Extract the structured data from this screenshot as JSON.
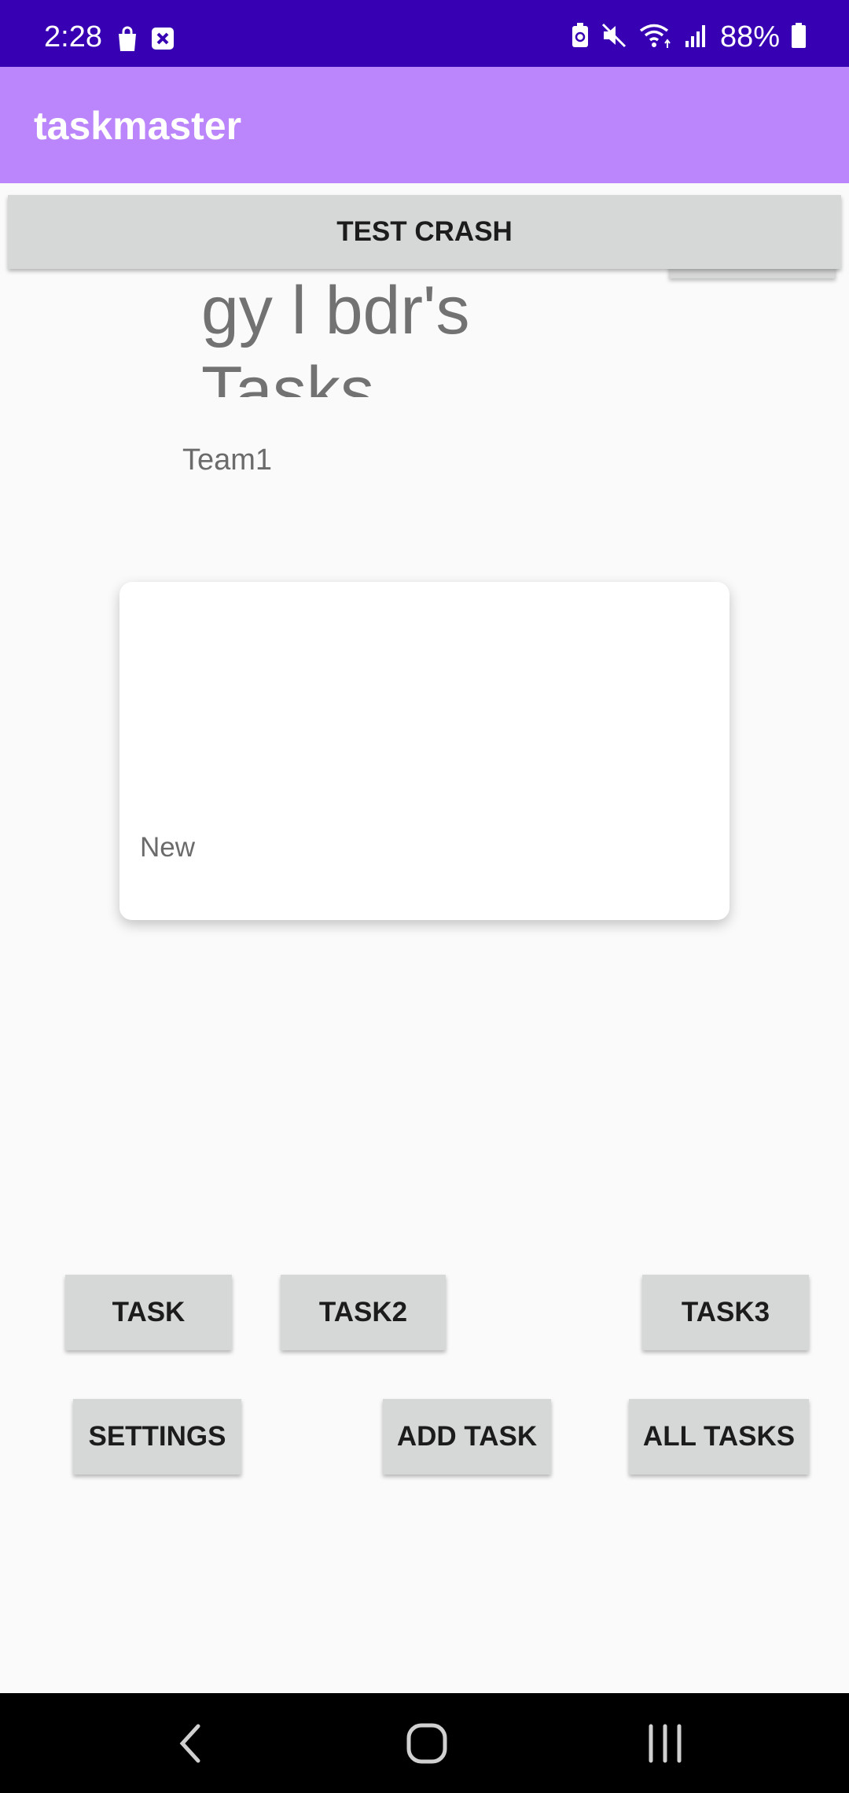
{
  "status_bar": {
    "time": "2:28",
    "battery": "88%",
    "icons": [
      "shopping-bag-icon",
      "close-square-icon",
      "battery-saver-icon",
      "mute-icon",
      "wifi-icon",
      "signal-icon",
      "battery-icon"
    ]
  },
  "app_bar": {
    "title": "taskmaster"
  },
  "buttons": {
    "test_crash": "TEST CRASH",
    "task": "TASK",
    "task2": "TASK2",
    "task3": "TASK3",
    "settings": "SETTINGS",
    "add_task": "ADD TASK",
    "all_tasks": "ALL TASKS"
  },
  "heading": {
    "text": "gy l bdr's Tasks"
  },
  "team": {
    "name": "Team1"
  },
  "task_card": {
    "status": "New"
  },
  "nav_bar": {
    "icons": [
      "back-icon",
      "home-icon",
      "recents-icon"
    ]
  },
  "colors": {
    "status_bar": "#3700b3",
    "app_bar": "#bb86fc",
    "button_bg": "#d6d7d7",
    "background": "#fafafa"
  }
}
